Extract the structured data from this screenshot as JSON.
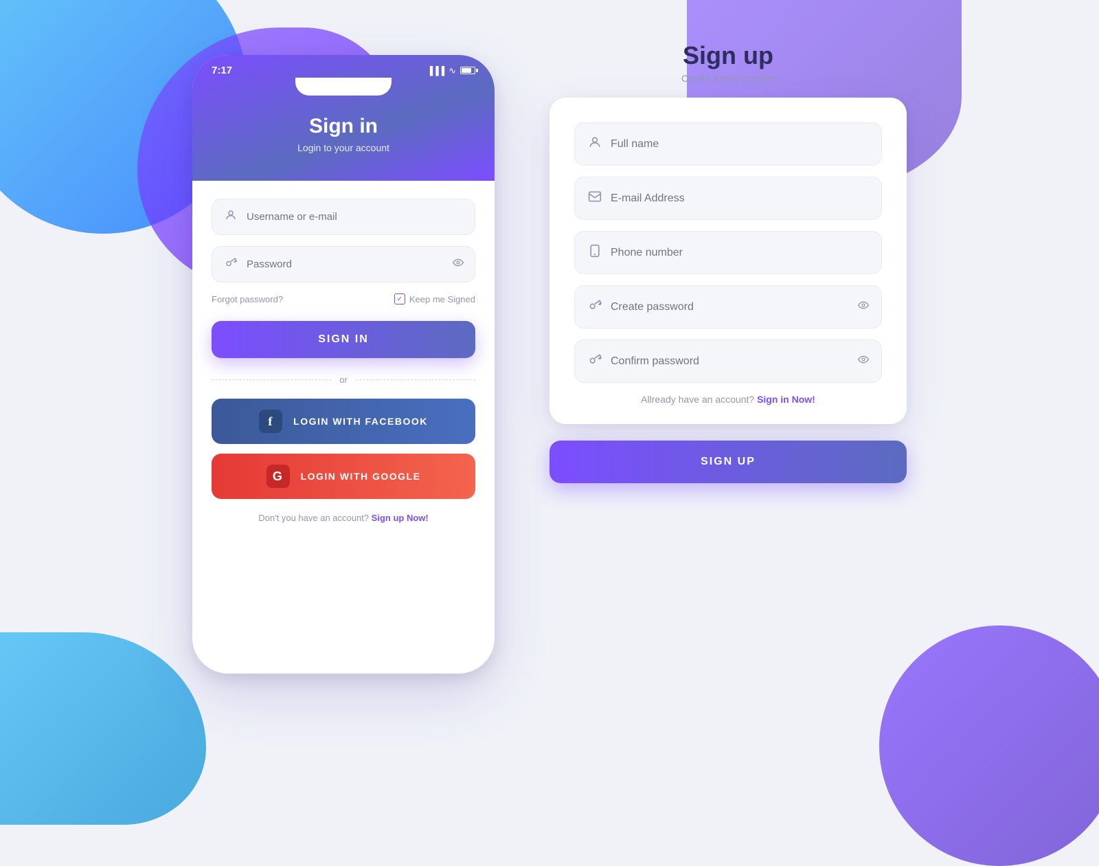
{
  "background": {
    "color": "#f0f2f8"
  },
  "signin": {
    "status_bar": {
      "time": "7:17"
    },
    "title": "Sign in",
    "subtitle": "Login to your account",
    "username_placeholder": "Username or e-mail",
    "password_placeholder": "Password",
    "forgot_password": "Forgot password?",
    "keep_signed": "Keep me Signed",
    "sign_in_button": "SIGN IN",
    "divider_text": "or",
    "facebook_button": "LOGIN WITH FACEBOOK",
    "google_button": "LOGIN WITH GOOGLE",
    "footer_text": "Don't you have an account?",
    "footer_link": "Sign up Now!"
  },
  "signup": {
    "title": "Sign up",
    "subtitle": "Create a new account",
    "fullname_placeholder": "Full name",
    "email_placeholder": "E-mail Address",
    "phone_placeholder": "Phone number",
    "create_password_placeholder": "Create password",
    "confirm_password_placeholder": "Confirm password",
    "already_text": "Allready have an account?",
    "signin_link": "Sign in Now!",
    "sign_up_button": "SIGN UP"
  }
}
